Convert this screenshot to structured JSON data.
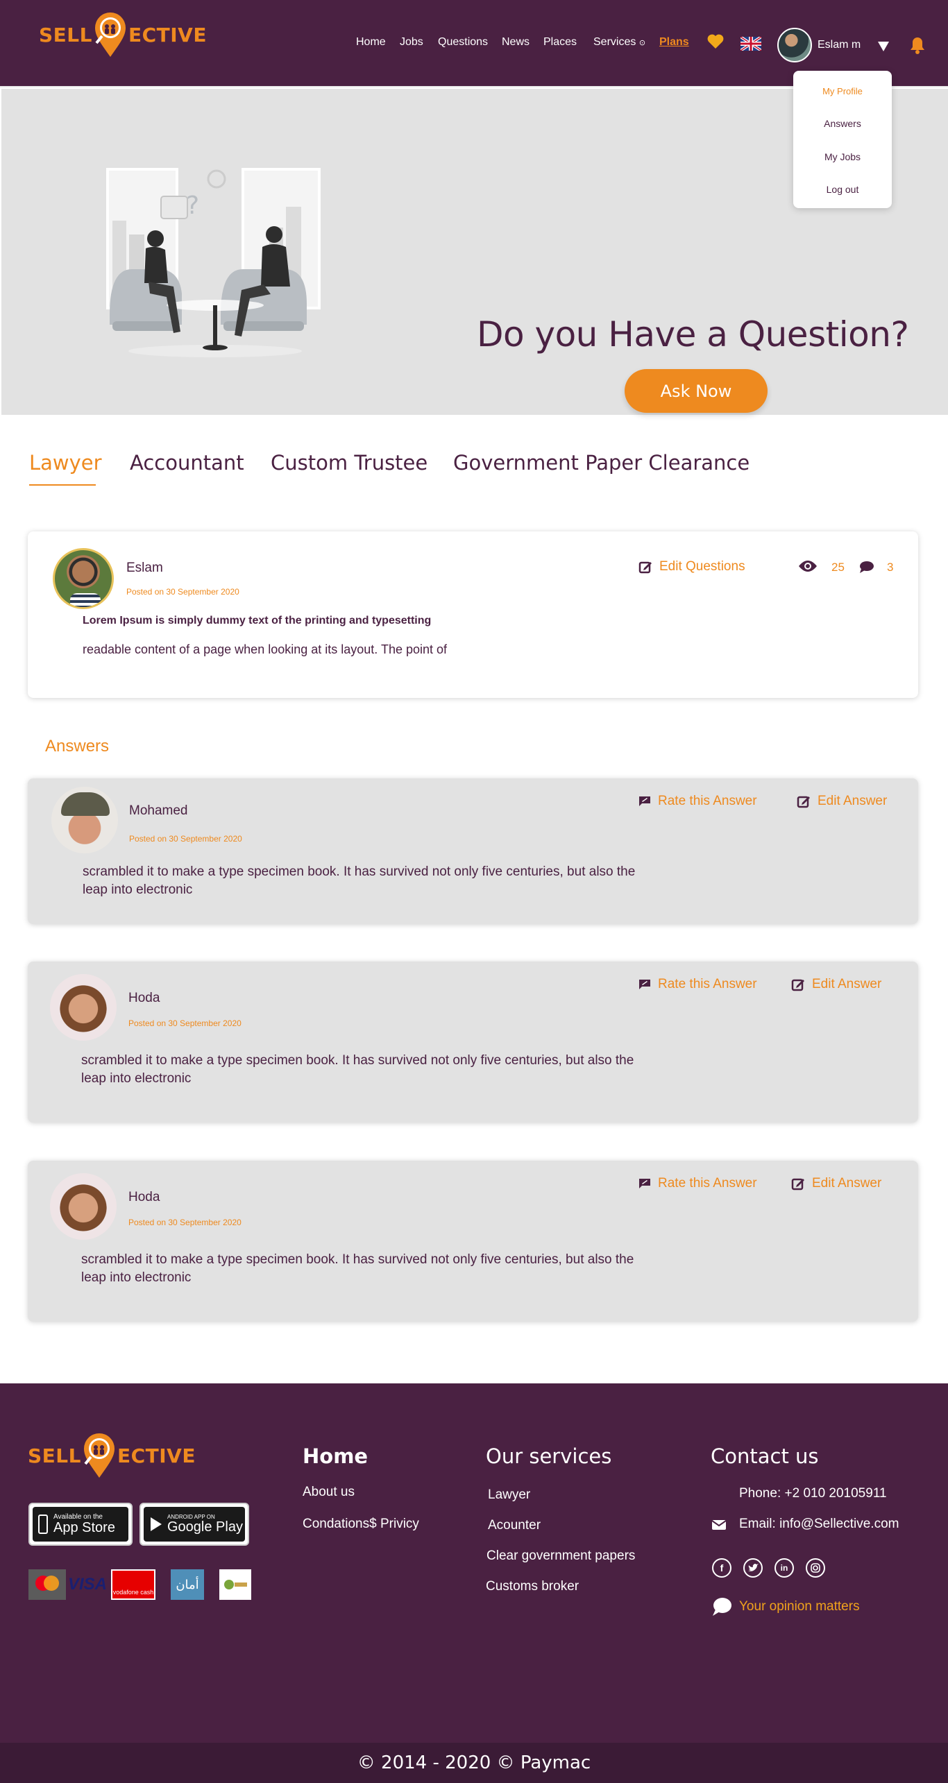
{
  "brand": {
    "logo_left": "SELL",
    "logo_right": "ECTIVE"
  },
  "nav": {
    "items": [
      "Home",
      "Jobs",
      "Questions",
      "News",
      "Places",
      "Services",
      "Plans"
    ],
    "user_name": "Eslam m"
  },
  "dropdown": {
    "items": [
      "My Profile",
      "Answers",
      "My Jobs",
      "Log out"
    ]
  },
  "hero": {
    "title": "Do you Have a Question?",
    "button": "Ask Now"
  },
  "tabs": [
    "Lawyer",
    "Accountant",
    "Custom Trustee",
    "Government Paper Clearance"
  ],
  "question": {
    "author": "Eslam",
    "posted": "Posted on 30 September 2020",
    "edit_label": "Edit Questions",
    "views": "25",
    "comments": "3",
    "title": "Lorem Ipsum is simply dummy text of the printing and typesetting",
    "body": "readable content of a page when looking at its layout. The point of"
  },
  "answers_title": "Answers",
  "answer_actions": {
    "rate": "Rate this Answer",
    "edit": "Edit Answer"
  },
  "answers": [
    {
      "author": "Mohamed",
      "posted": "Posted on 30 September 2020",
      "body": "scrambled it to make a type specimen book. It has survived not only five centuries, but also the leap into electronic"
    },
    {
      "author": "Hoda",
      "posted": "Posted on 30 September 2020",
      "body": "scrambled it to make a type specimen book. It has survived not only five centuries, but also the leap into electronic"
    },
    {
      "author": "Hoda",
      "posted": "Posted on 30 September 2020",
      "body": "scrambled it to make a type specimen book. It has survived not only five centuries, but also the leap into electronic"
    }
  ],
  "footer": {
    "col1": {
      "heading": "Home",
      "links": [
        "About us",
        "Condations$ Privicy"
      ]
    },
    "col2": {
      "heading": "Our services",
      "links": [
        "Lawyer",
        "Acounter",
        "Clear government papers",
        "Customs broker"
      ]
    },
    "col3": {
      "heading": "Contact us",
      "phone": "Phone: +2 010 20105911",
      "email": "Email: info@Sellective.com",
      "opinion": "Your opinion matters"
    },
    "stores": {
      "app_store_top": "Available on the",
      "app_store": "App Store",
      "google_top": "ANDROID APP ON",
      "google": "Google Play"
    },
    "payments": {
      "visa": "VISA",
      "vodafone": "vodafone cash",
      "aman": "أمان"
    }
  },
  "copyright": "© 2014 - 2020 © Paymac",
  "colors": {
    "primary": "#4a2142",
    "accent": "#ee8a1f",
    "card": "#e2e2e2"
  }
}
